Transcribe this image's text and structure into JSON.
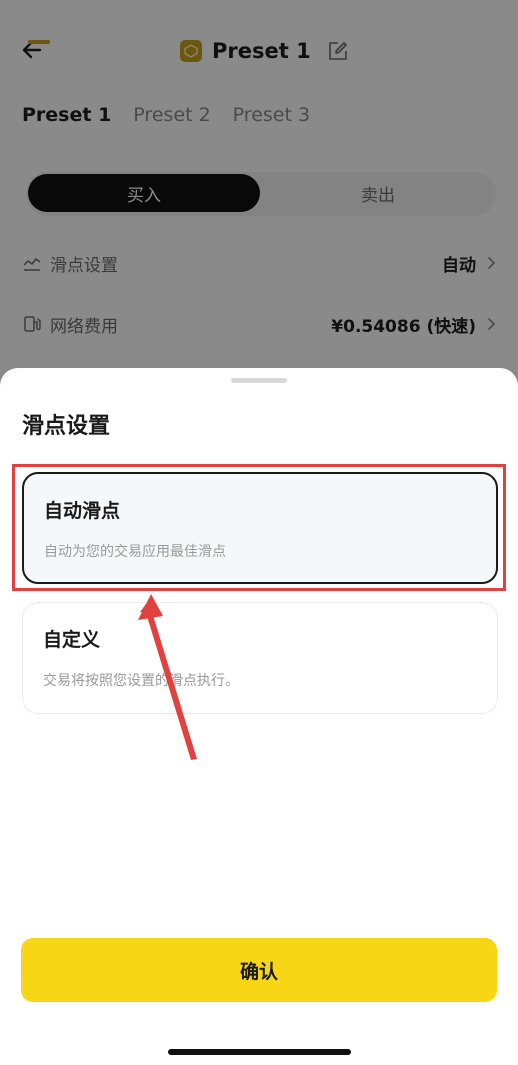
{
  "header": {
    "title": "Preset 1",
    "back_icon": "arrow-left-icon",
    "edit_icon": "edit-icon",
    "logo_icon": "preset-logo-icon"
  },
  "tabs": [
    {
      "label": "Preset 1",
      "active": true
    },
    {
      "label": "Preset 2",
      "active": false
    },
    {
      "label": "Preset 3",
      "active": false
    }
  ],
  "trade_toggle": {
    "buy_label": "买入",
    "sell_label": "卖出",
    "selected": "buy"
  },
  "settings": {
    "slippage": {
      "label": "滑点设置",
      "value": "自动"
    },
    "network_fee": {
      "label": "网络费用",
      "value": "¥0.54086 (快速)"
    }
  },
  "sheet": {
    "title": "滑点设置",
    "options": [
      {
        "title": "自动滑点",
        "description": "自动为您的交易应用最佳滑点",
        "selected": true
      },
      {
        "title": "自定义",
        "description": "交易将按照您设置的滑点执行。",
        "selected": false
      }
    ],
    "confirm_label": "确认"
  },
  "colors": {
    "accent_yellow": "#f6d615",
    "brand_gold": "#c9a11a",
    "annotation_red": "#e0423f",
    "dark": "#111111"
  }
}
